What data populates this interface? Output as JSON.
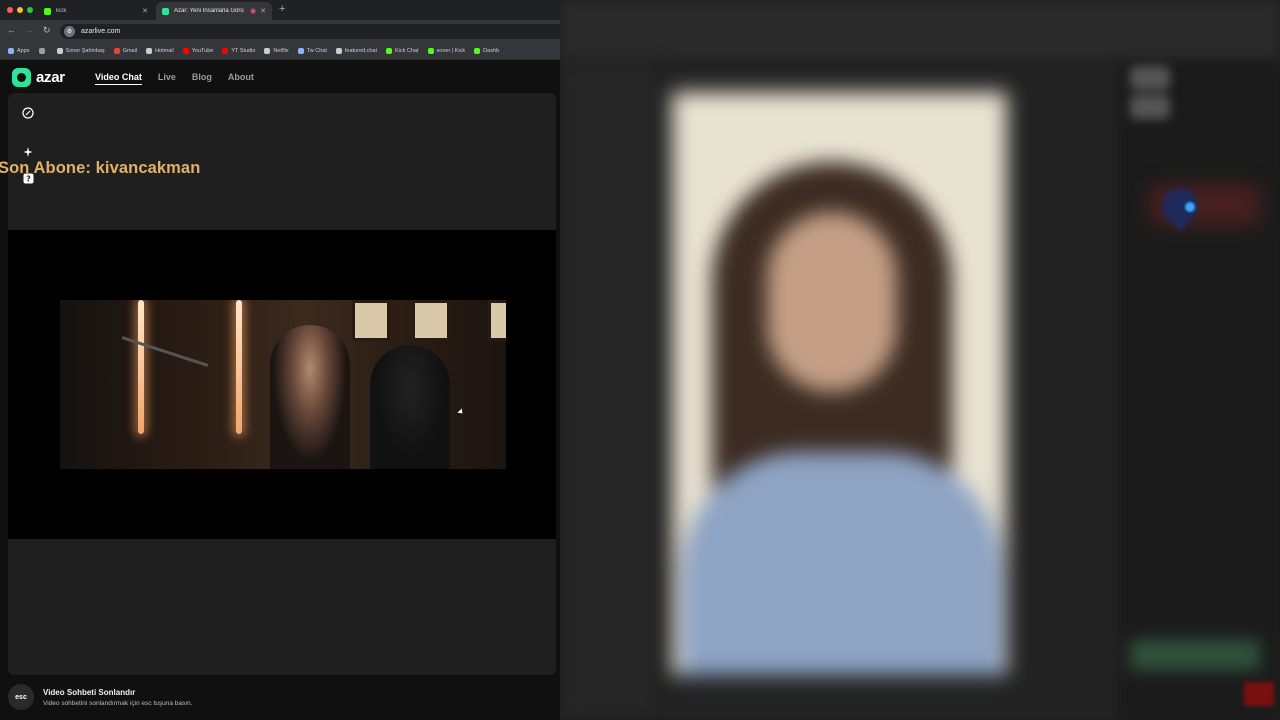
{
  "browser": {
    "tabs": [
      {
        "label": "kick",
        "favicon_color": "#53fc18",
        "active": false
      },
      {
        "label": "Azar: Yeni İnsanlarla Görü",
        "favicon_color": "#2fe39a",
        "active": true
      }
    ],
    "new_tab": "+",
    "url": "azarlive.com",
    "bookmarks": [
      {
        "label": "Apps",
        "color": "#8ab4f8"
      },
      {
        "label": "",
        "color": "#9e9e9e"
      },
      {
        "label": "Soner Şahinbaş",
        "color": "#cccccc"
      },
      {
        "label": "Gmail",
        "color": "#ea4335"
      },
      {
        "label": "Hotmail",
        "color": "#cccccc"
      },
      {
        "label": "YouTube",
        "color": "#ff0000"
      },
      {
        "label": "YT Studio",
        "color": "#ff0000"
      },
      {
        "label": "Netflix",
        "color": "#cccccc"
      },
      {
        "label": "Tw Chat",
        "color": "#8ab4f8"
      },
      {
        "label": "featured.chat",
        "color": "#cccccc"
      },
      {
        "label": "Kick Chat",
        "color": "#53fc18"
      },
      {
        "label": "soner | Kick",
        "color": "#53fc18"
      },
      {
        "label": "Dashb",
        "color": "#53fc18"
      }
    ]
  },
  "azar": {
    "logo_text": "azar",
    "nav": [
      {
        "label": "Video Chat",
        "active": true
      },
      {
        "label": "Live",
        "active": false
      },
      {
        "label": "Blog",
        "active": false
      },
      {
        "label": "About",
        "active": false
      }
    ],
    "overlay_text": "Son Abone: kivancakman",
    "esc_hint": {
      "key": "esc",
      "title": "Video Sohbeti Sonlandır",
      "subtitle": "Video sohbetini sonlandırmak için esc tuşuna basın."
    }
  },
  "colors": {
    "accent": "#2fe39a",
    "overlay_text": "#e0b168"
  }
}
